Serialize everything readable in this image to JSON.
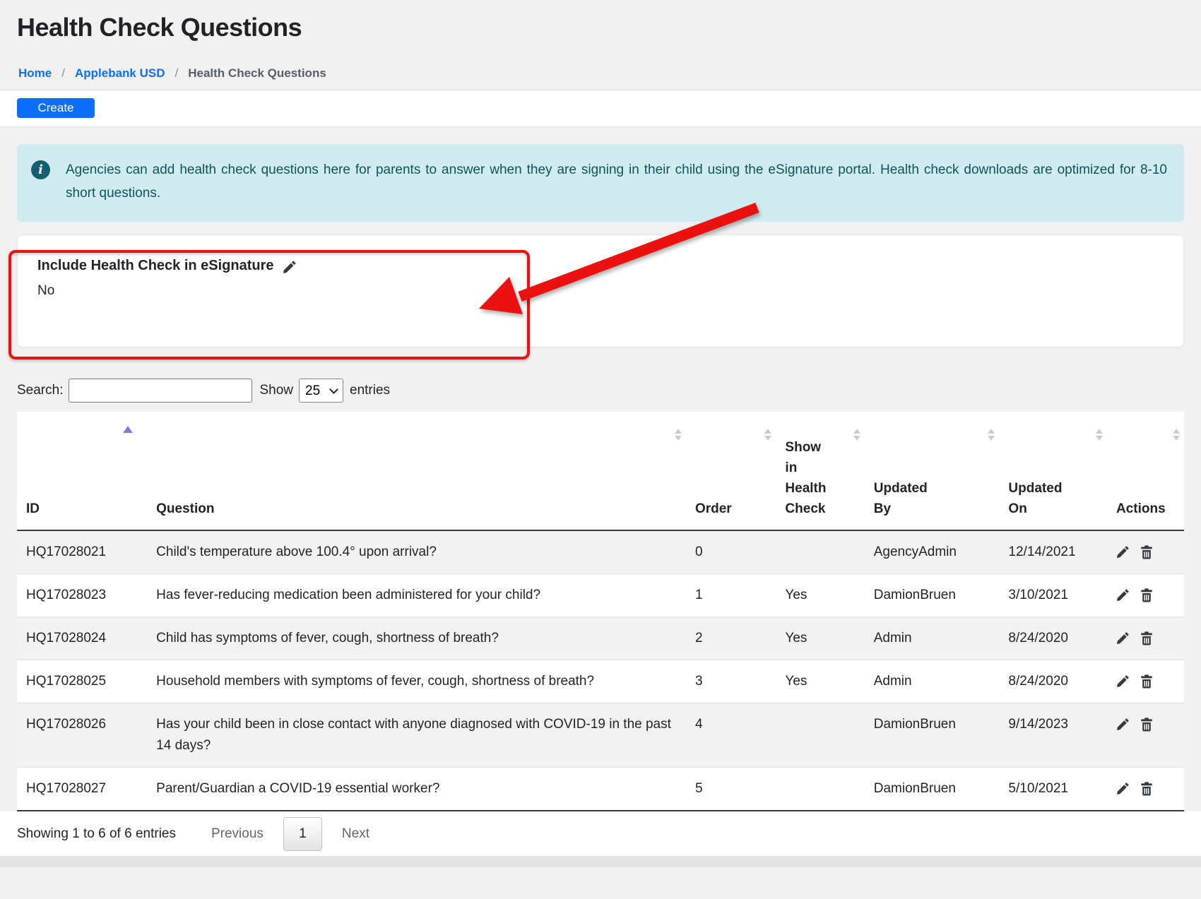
{
  "page": {
    "title": "Health Check Questions"
  },
  "breadcrumb": {
    "separator": "/",
    "home": "Home",
    "agency": "Applebank USD",
    "current": "Health Check Questions"
  },
  "toolbar": {
    "create_label": "Create"
  },
  "alert": {
    "icon": "info-icon",
    "text": "Agencies can add health check questions here for parents to answer when they are signing in their child using the eSignature portal. Health check downloads are optimized for 8-10 short questions."
  },
  "esignature_card": {
    "title": "Include Health Check in eSignature",
    "value": "No",
    "edit_icon": "pencil-icon"
  },
  "annotations": {
    "highlight_box": "red-rectangle around Include Health Check in eSignature card",
    "arrow": "red arrow pointing to the card",
    "color": "#ec1111"
  },
  "controls": {
    "search_label": "Search:",
    "search_value": "",
    "show_label": "Show",
    "page_size": "25",
    "entries_label": "entries"
  },
  "table": {
    "columns": [
      "ID",
      "Question",
      "Order",
      "Show in Health Check",
      "Updated By",
      "Updated On",
      "Actions"
    ],
    "sort": {
      "column": "ID",
      "direction": "ascending"
    },
    "rows": [
      {
        "id": "HQ17028021",
        "question": "Child's temperature above 100.4° upon arrival?",
        "order": "0",
        "show_in_health_check": "",
        "updated_by": "AgencyAdmin",
        "updated_on": "12/14/2021"
      },
      {
        "id": "HQ17028023",
        "question": "Has fever-reducing medication been administered for your child?",
        "order": "1",
        "show_in_health_check": "Yes",
        "updated_by": "DamionBruen",
        "updated_on": "3/10/2021"
      },
      {
        "id": "HQ17028024",
        "question": "Child has symptoms of fever, cough, shortness of breath?",
        "order": "2",
        "show_in_health_check": "Yes",
        "updated_by": "Admin",
        "updated_on": "8/24/2020"
      },
      {
        "id": "HQ17028025",
        "question": "Household members with symptoms of fever, cough, shortness of breath?",
        "order": "3",
        "show_in_health_check": "Yes",
        "updated_by": "Admin",
        "updated_on": "8/24/2020"
      },
      {
        "id": "HQ17028026",
        "question": "Has your child been in close contact with anyone diagnosed with COVID-19 in the past 14 days?",
        "order": "4",
        "show_in_health_check": "",
        "updated_by": "DamionBruen",
        "updated_on": "9/14/2023"
      },
      {
        "id": "HQ17028027",
        "question": "Parent/Guardian a COVID-19 essential worker?",
        "order": "5",
        "show_in_health_check": "",
        "updated_by": "DamionBruen",
        "updated_on": "5/10/2021"
      }
    ],
    "row_action_icons": [
      "pencil-icon",
      "trash-icon"
    ]
  },
  "pagination": {
    "summary": "Showing 1 to 6 of 6 entries",
    "previous_label": "Previous",
    "page": "1",
    "next_label": "Next"
  },
  "colors": {
    "accent_blue": "#0d6efd",
    "alert_background": "#d1ecf1",
    "alert_text": "#0c5460",
    "info_icon_background": "#145e70",
    "annotation_red": "#ec1111",
    "active_sort": "#7c7ce0",
    "stripe_gray": "#f2f2f2"
  }
}
